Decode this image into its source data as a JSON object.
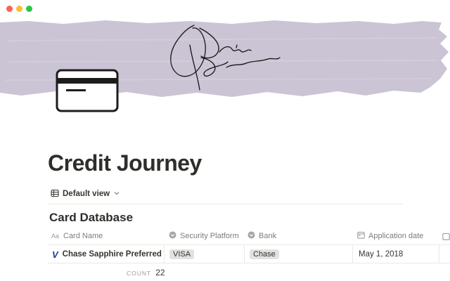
{
  "window": {
    "controls": [
      "close",
      "minimize",
      "zoom"
    ],
    "colors": {
      "close": "#ff5f57",
      "minimize": "#febc2e",
      "zoom": "#28c840"
    }
  },
  "cover": {
    "color": "#cbc4d4",
    "image": "brush-stroke-signature"
  },
  "page": {
    "icon": "credit-card-icon",
    "title": "Credit Journey"
  },
  "view": {
    "label": "Default view",
    "icon": "table-icon"
  },
  "database": {
    "title": "Card Database",
    "columns": [
      {
        "label": "Card Name",
        "icon": "text-icon"
      },
      {
        "label": "Security Platform",
        "icon": "select-icon"
      },
      {
        "label": "Bank",
        "icon": "select-icon"
      },
      {
        "label": "Application date",
        "icon": "calendar-icon"
      }
    ],
    "rows": [
      {
        "icon": "V",
        "name": "Chase Sapphire Preferred",
        "security_platform": "VISA",
        "bank": "Chase",
        "application_date": "May 1, 2018"
      }
    ],
    "count_label": "COUNT",
    "count_value": "22"
  }
}
